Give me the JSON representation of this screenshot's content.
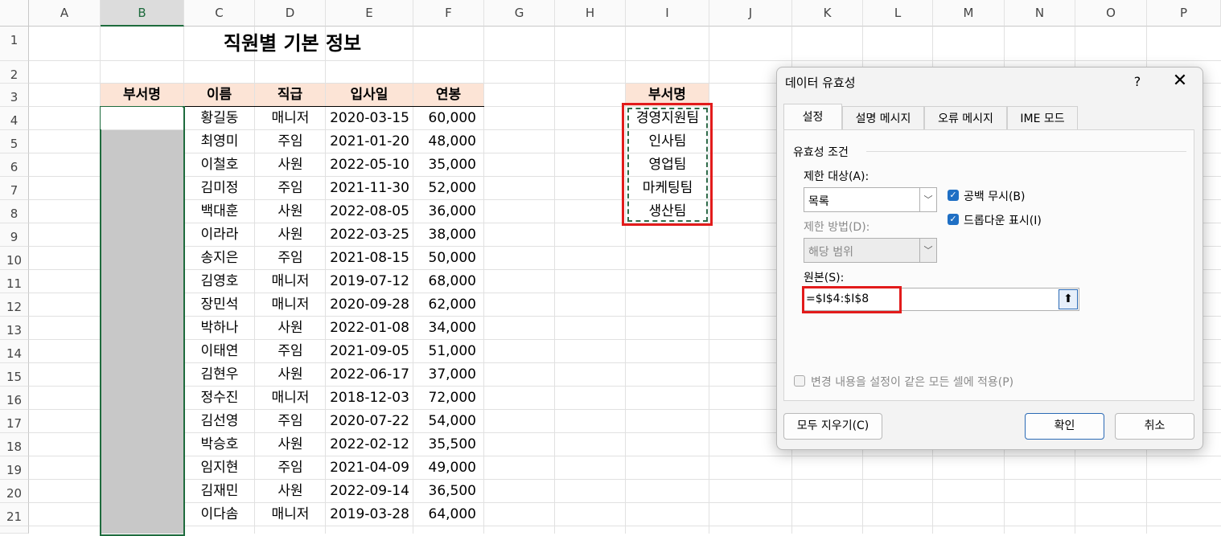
{
  "columns": [
    "A",
    "B",
    "C",
    "D",
    "E",
    "F",
    "G",
    "H",
    "I",
    "J",
    "K",
    "L",
    "M",
    "N",
    "O",
    "P"
  ],
  "selected_column": "B",
  "rows": [
    "1",
    "2",
    "3",
    "4",
    "5",
    "6",
    "7",
    "8",
    "9",
    "10",
    "11",
    "12",
    "13",
    "14",
    "15",
    "16",
    "17",
    "18",
    "19",
    "20",
    "21"
  ],
  "title": "직원별 기본 정보",
  "table_headers": [
    "부서명",
    "이름",
    "직급",
    "입사일",
    "연봉"
  ],
  "employees": [
    [
      "황길동",
      "매니저",
      "2020-03-15",
      "60,000"
    ],
    [
      "최영미",
      "주임",
      "2021-01-20",
      "48,000"
    ],
    [
      "이철호",
      "사원",
      "2022-05-10",
      "35,000"
    ],
    [
      "김미정",
      "주임",
      "2021-11-30",
      "52,000"
    ],
    [
      "백대훈",
      "사원",
      "2022-08-05",
      "36,000"
    ],
    [
      "이라라",
      "사원",
      "2022-03-25",
      "38,000"
    ],
    [
      "송지은",
      "주임",
      "2021-08-15",
      "50,000"
    ],
    [
      "김영호",
      "매니저",
      "2019-07-12",
      "68,000"
    ],
    [
      "장민석",
      "매니저",
      "2020-09-28",
      "62,000"
    ],
    [
      "박하나",
      "사원",
      "2022-01-08",
      "34,000"
    ],
    [
      "이태연",
      "주임",
      "2021-09-05",
      "51,000"
    ],
    [
      "김현우",
      "사원",
      "2022-06-17",
      "37,000"
    ],
    [
      "정수진",
      "매니저",
      "2018-12-03",
      "72,000"
    ],
    [
      "김선영",
      "주임",
      "2020-07-22",
      "54,000"
    ],
    [
      "박승호",
      "사원",
      "2022-02-12",
      "35,500"
    ],
    [
      "임지현",
      "주임",
      "2021-04-09",
      "49,000"
    ],
    [
      "김재민",
      "사원",
      "2022-09-14",
      "36,500"
    ],
    [
      "이다솜",
      "매니저",
      "2019-03-28",
      "64,000"
    ]
  ],
  "dept_list": {
    "header": "부서명",
    "items": [
      "경영지원팀",
      "인사팀",
      "영업팀",
      "마케팅팀",
      "생산팀"
    ]
  },
  "dialog": {
    "title": "데이터 유효성",
    "help": "?",
    "close": "✕",
    "tabs": [
      "설정",
      "설명 메시지",
      "오류 메시지",
      "IME 모드"
    ],
    "active_tab": "설정",
    "section": "유효성 조건",
    "allow_label": "제한 대상(A):",
    "allow_value": "목록",
    "data_label": "제한 방법(D):",
    "data_value": "해당 범위",
    "ignore_blank": "공백 무시(B)",
    "in_cell_dropdown": "드롭다운 표시(I)",
    "source_label": "원본(S):",
    "source_value": "=$I$4:$I$8",
    "apply_all": "변경 내용을 설정이 같은 모든 셀에 적용(P)",
    "clear_all": "모두 지우기(C)",
    "ok": "확인",
    "cancel": "취소"
  },
  "colors": {
    "header_fill": "#fce4d6",
    "selection": "#1e6b3d",
    "highlight_box": "#e21b1b",
    "checkbox": "#1f6fc4"
  }
}
